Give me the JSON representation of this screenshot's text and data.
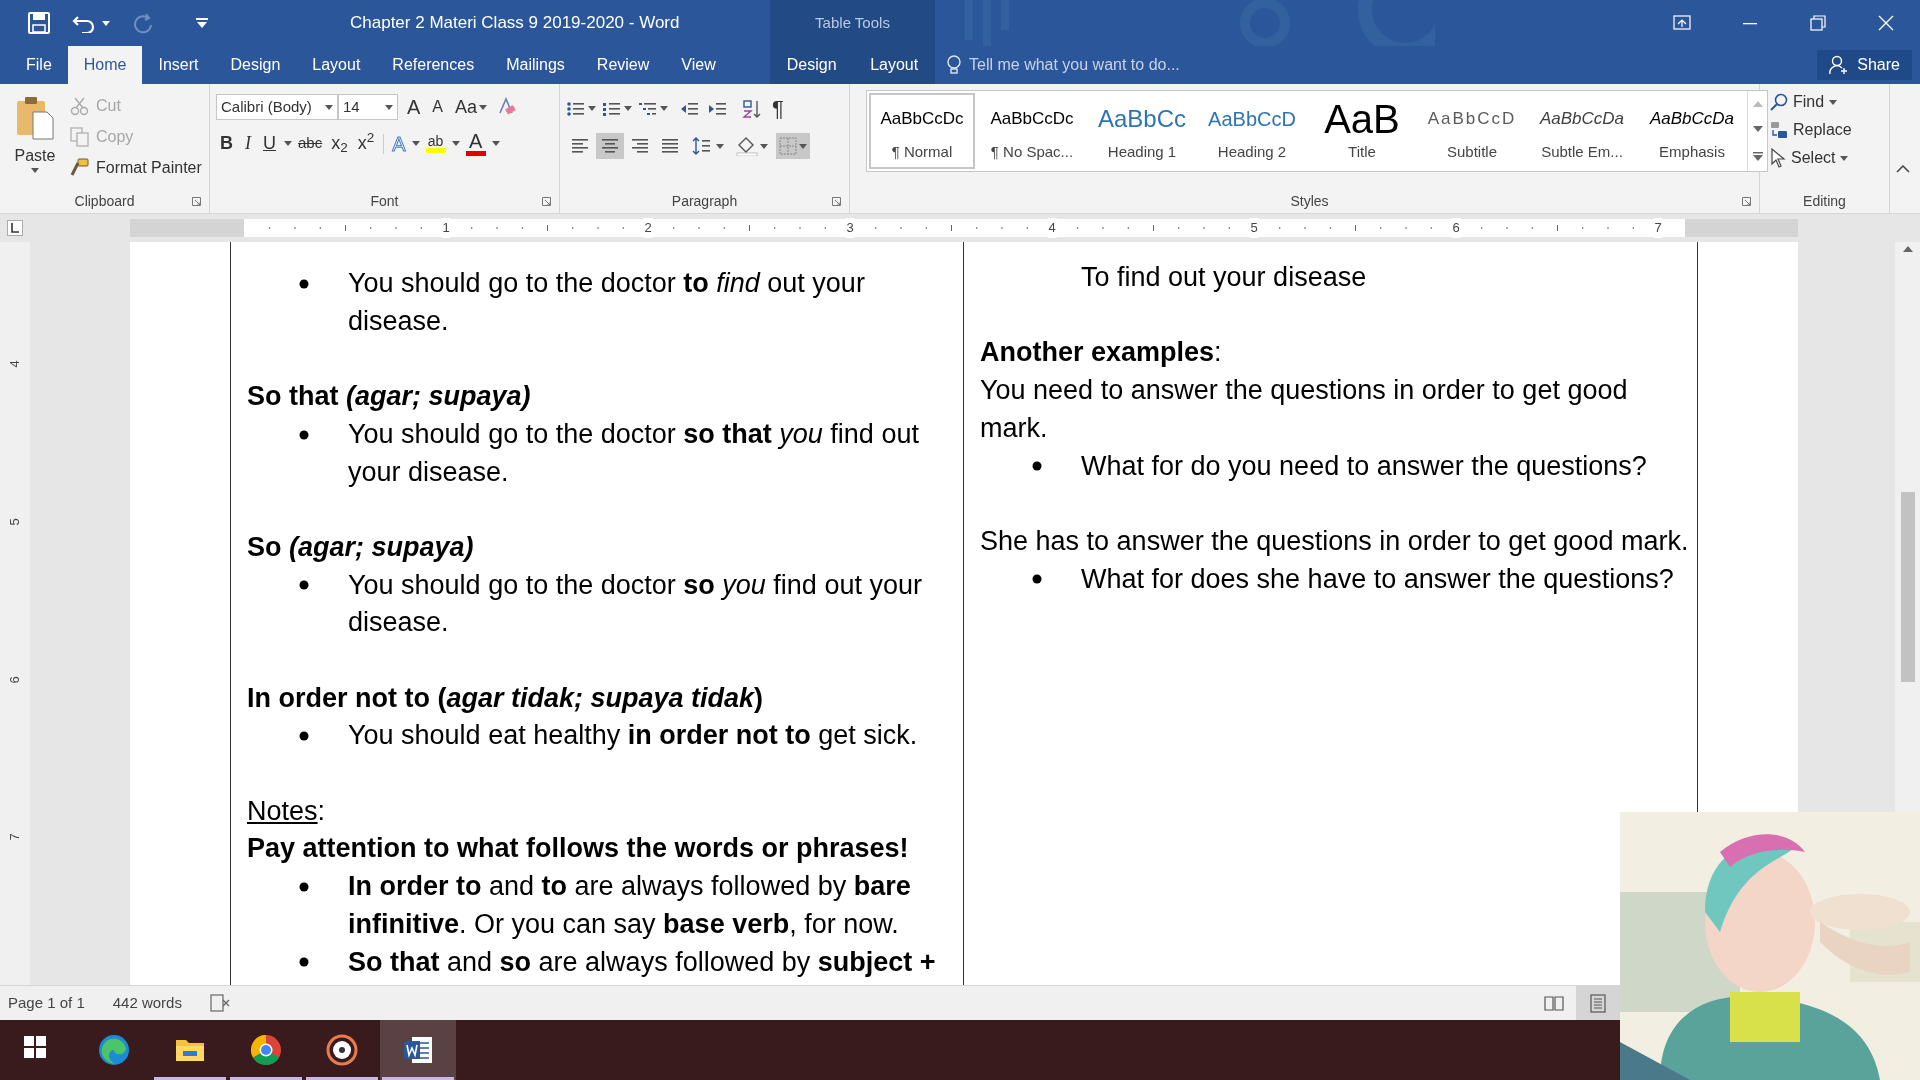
{
  "window": {
    "title": "Chapter 2 Materi Class 9 2019-2020 - Word",
    "context_label": "Table Tools"
  },
  "ribbon_tabs": [
    {
      "label": "File",
      "selected": false,
      "contextual": false
    },
    {
      "label": "Home",
      "selected": true,
      "contextual": false
    },
    {
      "label": "Insert",
      "selected": false,
      "contextual": false
    },
    {
      "label": "Design",
      "selected": false,
      "contextual": false
    },
    {
      "label": "Layout",
      "selected": false,
      "contextual": false
    },
    {
      "label": "References",
      "selected": false,
      "contextual": false
    },
    {
      "label": "Mailings",
      "selected": false,
      "contextual": false
    },
    {
      "label": "Review",
      "selected": false,
      "contextual": false
    },
    {
      "label": "View",
      "selected": false,
      "contextual": false
    },
    {
      "label": "Design",
      "selected": false,
      "contextual": true
    },
    {
      "label": "Layout",
      "selected": false,
      "contextual": true
    }
  ],
  "tell_me": {
    "placeholder": "Tell me what you want to do..."
  },
  "share": "Share",
  "clipboard": {
    "paste": "Paste",
    "items": [
      {
        "kind": "cut",
        "label": "Cut",
        "disabled": true
      },
      {
        "kind": "copy",
        "label": "Copy",
        "disabled": true
      },
      {
        "kind": "format_painter",
        "label": "Format Painter",
        "disabled": false
      }
    ],
    "label": "Clipboard"
  },
  "font": {
    "name": "Calibri (Body)",
    "size": "14",
    "grow": "A",
    "shrink": "A",
    "case": "Aa",
    "format_buttons": [
      {
        "kind": "bold",
        "label": "B"
      },
      {
        "kind": "italic",
        "label": "I"
      },
      {
        "kind": "underline",
        "label": "U"
      },
      {
        "kind": "strike",
        "label": "abc"
      },
      {
        "kind": "sub",
        "label": "x$_{2}$"
      },
      {
        "kind": "sup",
        "label": "x$^{2}$"
      }
    ],
    "effect_buttons": [
      {
        "kind": "text_effects",
        "label": "A"
      },
      {
        "kind": "highlight",
        "label": "ab"
      },
      {
        "kind": "font_color",
        "label": "A"
      }
    ],
    "label": "Font"
  },
  "paragraph": {
    "show_marks": "¶",
    "alignment": [
      {
        "kind": "left",
        "selected": false
      },
      {
        "kind": "center",
        "selected": true
      },
      {
        "kind": "right",
        "selected": false
      },
      {
        "kind": "justify",
        "selected": false
      }
    ],
    "borders_active": true,
    "label": "Paragraph"
  },
  "styles": {
    "items": [
      {
        "kind": "normal",
        "sample": "AaBbCcDc",
        "name": "¶ Normal",
        "selected": true
      },
      {
        "kind": "no_spacing",
        "sample": "AaBbCcDc",
        "name": "¶ No Spac...",
        "selected": false
      },
      {
        "kind": "heading1",
        "sample": "AaBbCc",
        "name": "Heading 1",
        "selected": false
      },
      {
        "kind": "heading2",
        "sample": "AaBbCcD",
        "name": "Heading 2",
        "selected": false
      },
      {
        "kind": "title",
        "sample": "AaB",
        "name": "Title",
        "selected": false
      },
      {
        "kind": "subtitle",
        "sample": "AaBbCcD",
        "name": "Subtitle",
        "selected": false
      },
      {
        "kind": "subtle_emphasis",
        "sample": "AaBbCcDa",
        "name": "Subtle Em...",
        "selected": false
      },
      {
        "kind": "emphasis",
        "sample": "AaBbCcDa",
        "name": "Emphasis",
        "selected": false
      }
    ],
    "label": "Styles"
  },
  "editing": {
    "find": "Find",
    "replace": "Replace",
    "select": "Select",
    "label": "Editing"
  },
  "ruler": {
    "numbers": [
      "1",
      "2",
      "3",
      "4",
      "5",
      "6",
      "7"
    ],
    "vertical_numbers": [
      "4",
      "5",
      "6",
      "7"
    ]
  },
  "document": {
    "left_column": [
      {
        "kind": "bullet",
        "text": "You should go to the doctor **to** *find* out your disease."
      },
      {
        "kind": "blank"
      },
      {
        "kind": "heading",
        "text": "So that *(agar; supaya)*"
      },
      {
        "kind": "bullet",
        "text": "You should go to the doctor **so that** *you* find out your disease."
      },
      {
        "kind": "blank"
      },
      {
        "kind": "heading",
        "text": "So *(agar; supaya)*"
      },
      {
        "kind": "bullet",
        "text": "You should go to the doctor **so** *you* find out your disease."
      },
      {
        "kind": "blank"
      },
      {
        "kind": "heading",
        "text": "In order not to (*agar tidak; supaya tidak*)"
      },
      {
        "kind": "bullet",
        "text": "You should eat healthy **in order not to** get sick."
      },
      {
        "kind": "blank"
      },
      {
        "kind": "underlined_label",
        "text": "Notes",
        "after": ":"
      },
      {
        "kind": "heading",
        "text": "Pay attention to what follows the words or phrases!"
      },
      {
        "kind": "bullet",
        "text": "**In order to** and **to** are always followed by **bare infinitive**. Or you can say **base verb**, for now."
      },
      {
        "kind": "bullet",
        "text": "**So that** and **so** are always followed by **subject +**"
      }
    ],
    "right_column": [
      {
        "kind": "indent",
        "text": "To find out your disease"
      },
      {
        "kind": "blank"
      },
      {
        "kind": "text",
        "text": "**Another examples**:"
      },
      {
        "kind": "text",
        "text": "You need to answer the questions in order to get good mark."
      },
      {
        "kind": "bullet",
        "text": "What for do you need to answer the questions?"
      },
      {
        "kind": "blank"
      },
      {
        "kind": "text",
        "text": "She has to answer the questions in order to get good mark."
      },
      {
        "kind": "bullet",
        "text": "What for does she have to answer the questions?"
      }
    ]
  },
  "status_bar": {
    "page": "Page 1 of 1",
    "words": "442 words",
    "views": [
      {
        "kind": "read",
        "selected": false
      },
      {
        "kind": "print",
        "selected": true
      }
    ]
  },
  "taskbar": [
    {
      "kind": "start",
      "running": false,
      "selected": false
    },
    {
      "kind": "edge",
      "running": false,
      "selected": false
    },
    {
      "kind": "explorer",
      "running": true,
      "selected": false
    },
    {
      "kind": "chrome",
      "running": true,
      "selected": false
    },
    {
      "kind": "media",
      "running": true,
      "selected": false
    },
    {
      "kind": "word",
      "running": true,
      "selected": true
    }
  ]
}
